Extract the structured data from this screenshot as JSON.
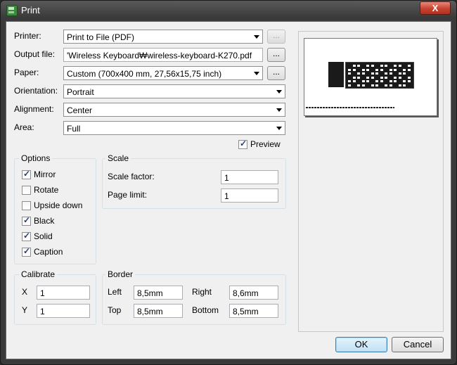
{
  "window": {
    "title": "Print",
    "close_label": "X"
  },
  "form": {
    "printer": {
      "label": "Printer:",
      "value": "Print to File (PDF)"
    },
    "output_file": {
      "label": "Output file:",
      "value": "'Wireless Keyboard₩wireless-keyboard-K270.pdf"
    },
    "paper": {
      "label": "Paper:",
      "value": "Custom (700x400 mm, 27,56x15,75 inch)"
    },
    "orientation": {
      "label": "Orientation:",
      "value": "Portrait"
    },
    "alignment": {
      "label": "Alignment:",
      "value": "Center"
    },
    "area": {
      "label": "Area:",
      "value": "Full"
    },
    "browse_label": "...",
    "preview": {
      "label": "Preview",
      "checked": true
    }
  },
  "options": {
    "title": "Options",
    "items": [
      {
        "label": "Mirror",
        "checked": true
      },
      {
        "label": "Rotate",
        "checked": false
      },
      {
        "label": "Upside down",
        "checked": false
      },
      {
        "label": "Black",
        "checked": true
      },
      {
        "label": "Solid",
        "checked": true
      },
      {
        "label": "Caption",
        "checked": true
      }
    ]
  },
  "scale": {
    "title": "Scale",
    "factor_label": "Scale factor:",
    "factor_value": "1",
    "limit_label": "Page limit:",
    "limit_value": "1"
  },
  "calibrate": {
    "title": "Calibrate",
    "x_label": "X",
    "x_value": "1",
    "y_label": "Y",
    "y_value": "1"
  },
  "border": {
    "title": "Border",
    "left_label": "Left",
    "left_value": "8,5mm",
    "right_label": "Right",
    "right_value": "8,6mm",
    "top_label": "Top",
    "top_value": "8,5mm",
    "bottom_label": "Bottom",
    "bottom_value": "8,5mm"
  },
  "buttons": {
    "ok": "OK",
    "cancel": "Cancel"
  },
  "colors": {
    "accent": "#3c7fb1",
    "check": "#2a3f7a",
    "close": "#c7422f"
  }
}
